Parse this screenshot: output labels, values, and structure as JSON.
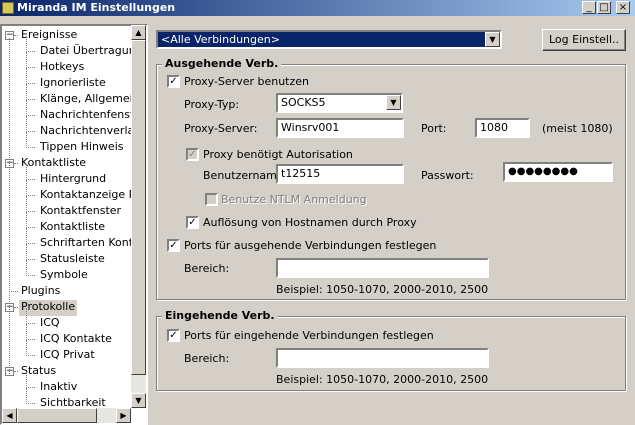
{
  "window": {
    "title": "Miranda IM Einstellungen",
    "controls": {
      "minimize": "_",
      "maximize": "□",
      "close": "×"
    }
  },
  "tree": [
    {
      "label": "Ereignisse",
      "level": 0,
      "expander": "−"
    },
    {
      "label": "Datei Übertragung",
      "level": 1
    },
    {
      "label": "Hotkeys",
      "level": 1
    },
    {
      "label": "Ignorierliste",
      "level": 1
    },
    {
      "label": "Klänge, Allgemein",
      "level": 1
    },
    {
      "label": "Nachrichtenfenster",
      "level": 1
    },
    {
      "label": "Nachrichtenverlauf",
      "level": 1
    },
    {
      "label": "Tippen Hinweis",
      "level": 1
    },
    {
      "label": "Kontaktliste",
      "level": 0,
      "expander": "−"
    },
    {
      "label": "Hintergrund",
      "level": 1
    },
    {
      "label": "Kontaktanzeige Rei",
      "level": 1
    },
    {
      "label": "Kontaktfenster",
      "level": 1
    },
    {
      "label": "Kontaktliste",
      "level": 1
    },
    {
      "label": "Schriftarten Kontak",
      "level": 1
    },
    {
      "label": "Statusleiste",
      "level": 1
    },
    {
      "label": "Symbole",
      "level": 1
    },
    {
      "label": "Plugins",
      "level": 0
    },
    {
      "label": "Protokolle",
      "level": 0,
      "expander": "−",
      "selected": true
    },
    {
      "label": "ICQ",
      "level": 1
    },
    {
      "label": "ICQ Kontakte",
      "level": 1
    },
    {
      "label": "ICQ Privat",
      "level": 1
    },
    {
      "label": "Status",
      "level": 0,
      "expander": "−"
    },
    {
      "label": "Inaktiv",
      "level": 1
    },
    {
      "label": "Sichtbarkeit",
      "level": 1
    }
  ],
  "connection_select": {
    "value": "<Alle Verbindungen>"
  },
  "log_button": "Log Einstell..",
  "outgoing": {
    "legend": "Ausgehende Verb.",
    "use_proxy": {
      "label": "Proxy-Server benutzen",
      "checked": true
    },
    "proxy_type": {
      "label": "Proxy-Typ:",
      "value": "SOCKS5"
    },
    "proxy_server": {
      "label": "Proxy-Server:",
      "value": "Winsrv001"
    },
    "port": {
      "label": "Port:",
      "value": "1080",
      "hint": "(meist 1080)"
    },
    "auth": {
      "label": "Proxy benötigt Autorisation",
      "checked": true
    },
    "username": {
      "label": "Benutzername:",
      "value": "t12515"
    },
    "password": {
      "label": "Passwort:",
      "value": "●●●●●●●●"
    },
    "ntlm": {
      "label": "Benutze NTLM Anmeldung",
      "checked": false
    },
    "resolve": {
      "label": "Auflösung von Hostnamen durch Proxy",
      "checked": true
    },
    "ports": {
      "label": "Ports für ausgehende Verbindungen festlegen",
      "checked": true
    },
    "range": {
      "label": "Bereich:",
      "value": "",
      "example": "Beispiel: 1050-1070, 2000-2010, 2500"
    }
  },
  "incoming": {
    "legend": "Eingehende Verb.",
    "ports": {
      "label": "Ports für eingehende Verbindungen festlegen",
      "checked": true
    },
    "range": {
      "label": "Bereich:",
      "value": "",
      "example": "Beispiel: 1050-1070, 2000-2010, 2500"
    }
  },
  "check_glyph": "✓"
}
